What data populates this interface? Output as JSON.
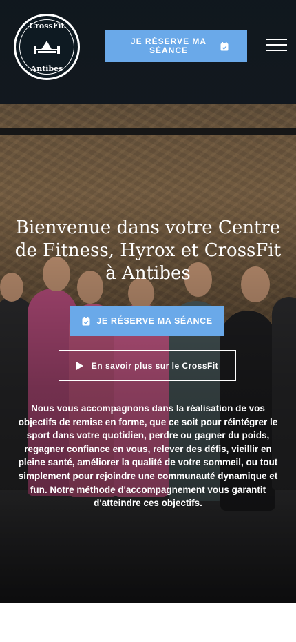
{
  "header": {
    "logo": {
      "top_text": "CrossFit",
      "bottom_text": "Antibes"
    },
    "cta_label": "JE RÉSERVE MA SÉANCE",
    "menu_icon": "hamburger-icon"
  },
  "hero": {
    "title": "Bienvenue dans votre Centre de Fitness, Hyrox et CrossFit à Antibes",
    "primary_cta": {
      "label": "JE RÉSERVE MA SÉANCE",
      "icon": "calendar-check-icon"
    },
    "secondary_cta": {
      "label": "En savoir plus sur le CrossFit",
      "icon": "play-icon"
    },
    "description": "Nous vous accompagnons dans la réalisation de vos objectifs de remise en forme, que ce soit pour réintégrer le sport dans votre quotidien, perdre ou gagner du poids, regagner confiance en vous, relever des défis, vieillir en pleine santé, améliorer la qualité de votre sommeil, ou tout simplement pour rejoindre une communauté dynamique et fun. Notre méthode d'accompagnement vous garantit d'atteindre ces objectifs."
  },
  "colors": {
    "accent": "#6aa9e9",
    "header_bg": "#0e1a22",
    "text": "#ffffff"
  }
}
